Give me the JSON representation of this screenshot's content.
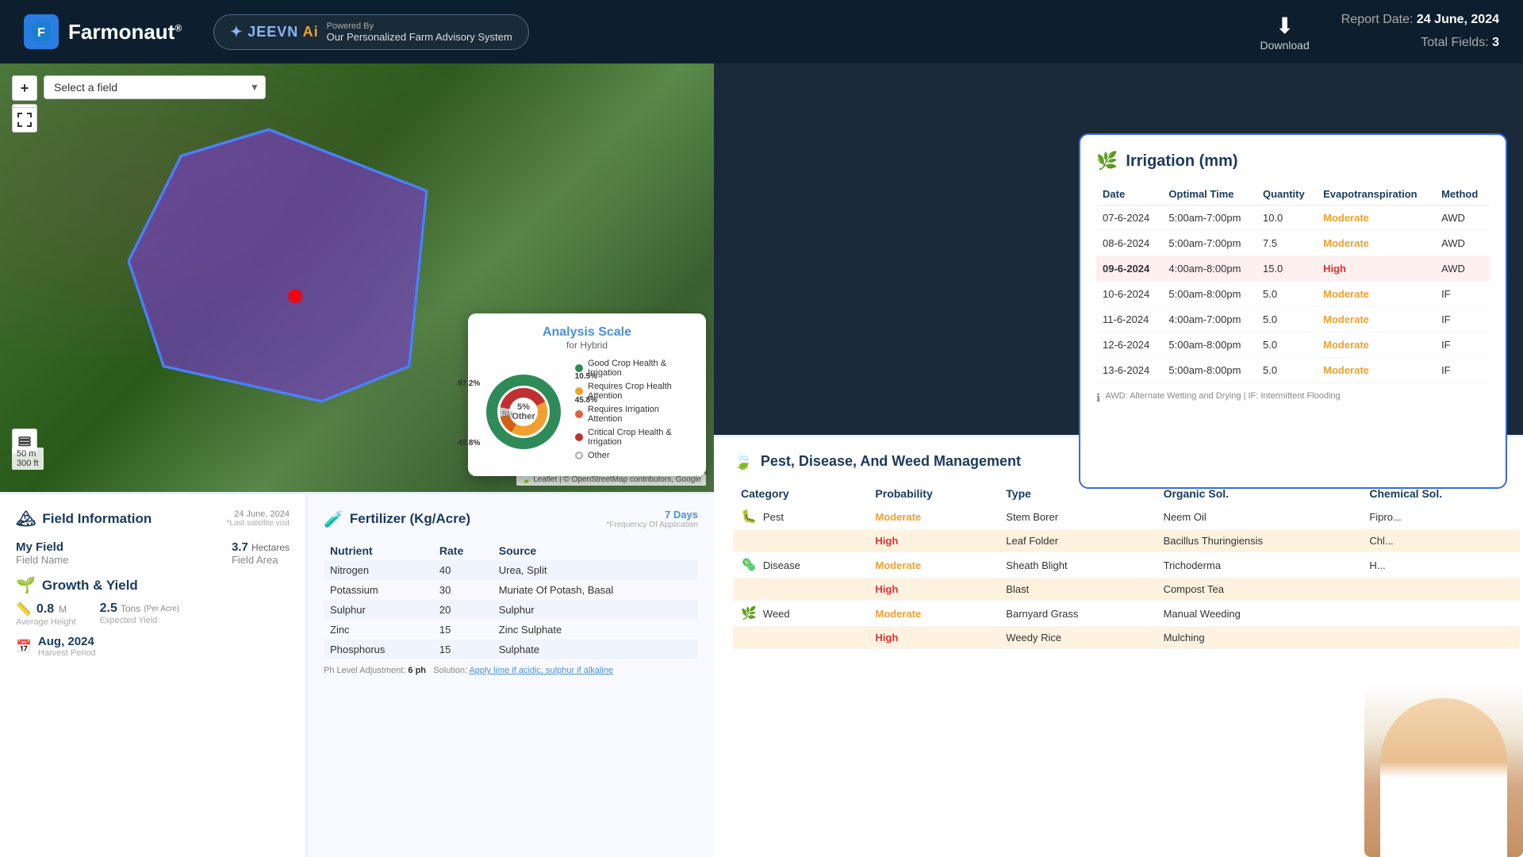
{
  "header": {
    "logo_text": "Farmonaut",
    "logo_reg": "®",
    "jeevn_name": "JEEVN",
    "jeevn_ai": "Ai",
    "powered_by": "Powered By",
    "tagline": "Our Personalized Farm Advisory System",
    "download_label": "Download",
    "report_label": "Report Date:",
    "report_date": "24 June, 2024",
    "total_fields_label": "Total Fields:",
    "total_fields": "3"
  },
  "map": {
    "select_placeholder": "Select a field",
    "zoom_in": "+",
    "zoom_out": "−",
    "scale_m": "50 m",
    "scale_ft": "300 ft",
    "attribution": "Leaflet | © OpenStreetMap contributors, Google"
  },
  "analysis_scale": {
    "title": "Analysis Scale",
    "subtitle": "for Hybrid",
    "center_label_1": "5%",
    "center_label_2": "Other",
    "pct_good": "97.2%",
    "pct_crop_irr": "10.5%",
    "pct_crop": "45.8%",
    "pct_other": "5%",
    "pct_irr": "40.8%",
    "legend": [
      {
        "color": "#2e8b57",
        "label": "Good Crop Health & Irrigation"
      },
      {
        "color": "#f0a030",
        "label": "Requires Crop Health Attention"
      },
      {
        "color": "#e06040",
        "label": "Requires Irrigation Attention"
      },
      {
        "color": "#c03030",
        "label": "Critical Crop Health & Irrigation"
      },
      {
        "color": "#ccc",
        "label": "Other",
        "ring": true
      }
    ]
  },
  "field_info": {
    "section_title": "Field Information",
    "date": "24 June, 2024",
    "last_satellite": "*Last satellite visit",
    "field_name_label": "Field Name",
    "field_name": "My Field",
    "field_area_label": "Field Area",
    "field_area": "3.7",
    "field_area_unit": "Hectares",
    "growth_title": "Growth & Yield",
    "avg_height_val": "0.8",
    "avg_height_unit": "M",
    "avg_height_label": "Average Height",
    "yield_val": "2.5",
    "yield_unit": "Tons",
    "yield_per": "(Per Acre)",
    "yield_label": "Expected Yield",
    "harvest_date": "Aug, 2024",
    "harvest_label": "Harvest Period"
  },
  "fertilizer": {
    "title": "Fertilizer (Kg/Acre)",
    "freq_days": "7 Days",
    "freq_label": "*Frequency Of Application",
    "cols": [
      "Nutrient",
      "Rate",
      "Source"
    ],
    "rows": [
      {
        "nutrient": "Nitrogen",
        "rate": "40",
        "source": "Urea, Split"
      },
      {
        "nutrient": "Potassium",
        "rate": "30",
        "source": "Muriate Of Potash, Basal"
      },
      {
        "nutrient": "Sulphur",
        "rate": "20",
        "source": "Sulphur"
      },
      {
        "nutrient": "Zinc",
        "rate": "15",
        "source": "Zinc Sulphate"
      },
      {
        "nutrient": "Phosphorus",
        "rate": "15",
        "source": "Sulphate"
      }
    ],
    "ph_label": "Ph Level Adjustment:",
    "ph_value": "6 ph",
    "solution_label": "Solution:",
    "solution_text": "Apply lime if acidic, sulphur if alkaline"
  },
  "irrigation": {
    "title": "Irrigation (mm)",
    "cols": [
      "Date",
      "Optimal Time",
      "Quantity",
      "Evapotranspiration",
      "Method"
    ],
    "rows": [
      {
        "date": "07-6-2024",
        "time": "5:00am-7:00pm",
        "qty": "10.0",
        "evap": "Moderate",
        "evap_level": "mod",
        "method": "AWD"
      },
      {
        "date": "08-6-2024",
        "time": "5:00am-7:00pm",
        "qty": "7.5",
        "evap": "Moderate",
        "evap_level": "mod",
        "method": "AWD"
      },
      {
        "date": "09-6-2024",
        "time": "4:00am-8:00pm",
        "qty": "15.0",
        "evap": "High",
        "evap_level": "high",
        "method": "AWD",
        "highlight": true
      },
      {
        "date": "10-6-2024",
        "time": "5:00am-8:00pm",
        "qty": "5.0",
        "evap": "Moderate",
        "evap_level": "mod",
        "method": "IF"
      },
      {
        "date": "11-6-2024",
        "time": "4:00am-7:00pm",
        "qty": "5.0",
        "evap": "Moderate",
        "evap_level": "mod",
        "method": "IF"
      },
      {
        "date": "12-6-2024",
        "time": "5:00am-8:00pm",
        "qty": "5.0",
        "evap": "Moderate",
        "evap_level": "mod",
        "method": "IF"
      },
      {
        "date": "13-6-2024",
        "time": "5:00am-8:00pm",
        "qty": "5.0",
        "evap": "Moderate",
        "evap_level": "mod",
        "method": "IF"
      }
    ],
    "footnote": "AWD: Alternate Wetting and Drying | IF: Intermittent Flooding"
  },
  "pest_management": {
    "title": "Pest, Disease, And Weed Management",
    "cols": [
      "Category",
      "Probability",
      "Type",
      "Organic Sol.",
      "Chemical Sol."
    ],
    "rows": [
      {
        "category": "Pest",
        "cat_icon": "🐛",
        "prob": "Moderate",
        "prob_level": "mod",
        "type": "Stem Borer",
        "organic": "Neem Oil",
        "chemical": "Fipro...",
        "highlight": false
      },
      {
        "category": "",
        "cat_icon": "",
        "prob": "High",
        "prob_level": "high",
        "type": "Leaf Folder",
        "organic": "Bacillus Thuringiensis",
        "chemical": "Chl...",
        "highlight": true
      },
      {
        "category": "Disease",
        "cat_icon": "🦠",
        "prob": "Moderate",
        "prob_level": "mod",
        "type": "Sheath Blight",
        "organic": "Trichoderma",
        "chemical": "H...",
        "highlight": false
      },
      {
        "category": "",
        "cat_icon": "",
        "prob": "High",
        "prob_level": "high",
        "type": "Blast",
        "organic": "Compost Tea",
        "chemical": "",
        "highlight": true
      },
      {
        "category": "Weed",
        "cat_icon": "🌿",
        "prob": "Moderate",
        "prob_level": "mod",
        "type": "Barnyard Grass",
        "organic": "Manual Weeding",
        "chemical": "",
        "highlight": false
      },
      {
        "category": "",
        "cat_icon": "",
        "prob": "High",
        "prob_level": "high",
        "type": "Weedy Rice",
        "organic": "Mulching",
        "chemical": "",
        "highlight": true
      }
    ],
    "disease_label": "Disease"
  }
}
